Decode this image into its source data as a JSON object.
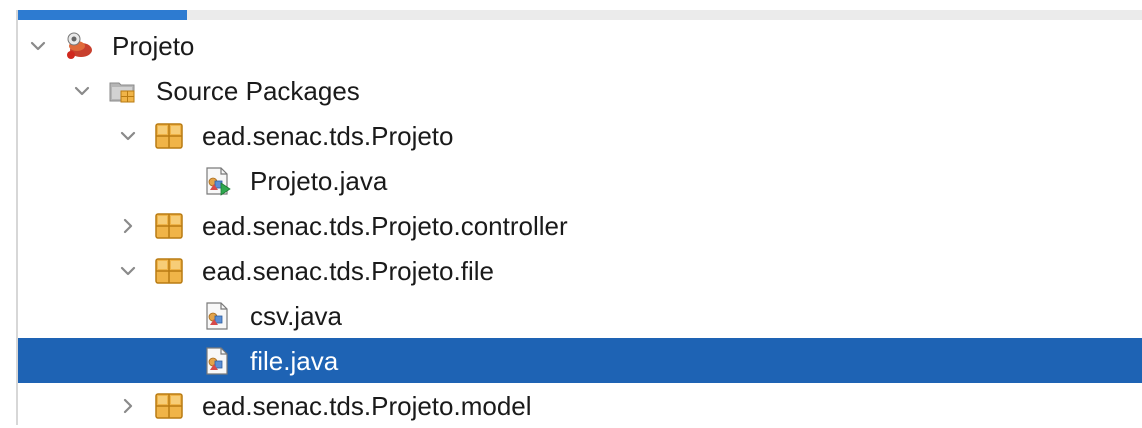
{
  "tree": {
    "progress_fraction": 0.15,
    "colors": {
      "selected_background": "#1e63b4",
      "selected_text": "#ffffff",
      "package_fill": "#f0b448",
      "package_border": "#b97b12",
      "toggle_color": "#8a8a8a",
      "progress": "#2d7bd1"
    },
    "nodes": [
      {
        "label": "Projeto",
        "level": 0,
        "toggle": "expanded",
        "icon": "maven-project-icon"
      },
      {
        "label": "Source Packages",
        "level": 1,
        "toggle": "expanded",
        "icon": "source-packages-folder-icon"
      },
      {
        "label": "ead.senac.tds.Projeto",
        "level": 2,
        "toggle": "expanded",
        "icon": "java-package-icon"
      },
      {
        "label": "Projeto.java",
        "level": 3,
        "toggle": "none",
        "icon": "java-main-class-icon"
      },
      {
        "label": "ead.senac.tds.Projeto.controller",
        "level": 2,
        "toggle": "collapsed",
        "icon": "java-package-icon"
      },
      {
        "label": "ead.senac.tds.Projeto.file",
        "level": 2,
        "toggle": "expanded",
        "icon": "java-package-icon"
      },
      {
        "label": "csv.java",
        "level": 3,
        "toggle": "none",
        "icon": "java-class-icon"
      },
      {
        "label": "file.java",
        "level": 3,
        "toggle": "none",
        "icon": "java-class-icon",
        "selected": true
      },
      {
        "label": "ead.senac.tds.Projeto.model",
        "level": 2,
        "toggle": "collapsed",
        "icon": "java-package-icon"
      }
    ]
  }
}
